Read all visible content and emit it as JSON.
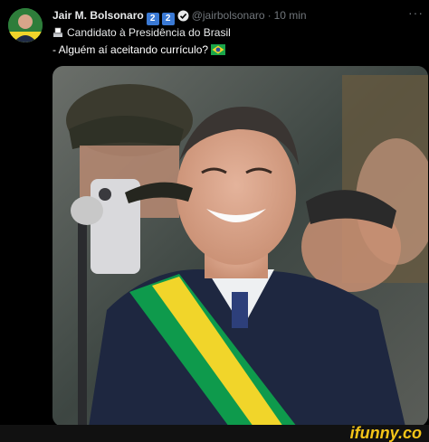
{
  "tweet": {
    "author_name": "Jair M. Bolsonaro",
    "badges": [
      "2",
      "2"
    ],
    "handle": "@jairbolsonaro",
    "separator": "·",
    "time": "10 min",
    "more_label": "···",
    "bio_line": "Candidato à Presidência do Brasil",
    "text": "- Alguém aí aceitando currículo?",
    "icons": {
      "verified": "verified-check-icon",
      "ballot": "ballot-box-icon",
      "flag": "brazil-flag-emoji"
    },
    "colors": {
      "background": "#000000",
      "text": "#e7e9ea",
      "muted": "#71767b",
      "badge": "#3a79d4",
      "sash_green": "#0e9a4c",
      "sash_yellow": "#f1d52a"
    }
  },
  "watermark": "ifunny.co"
}
